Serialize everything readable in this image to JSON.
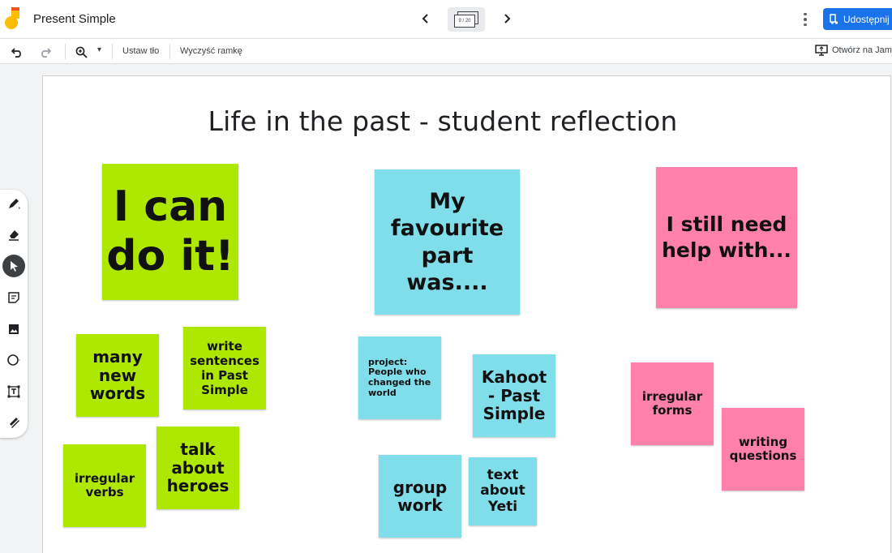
{
  "app": {
    "title": "Present Simple",
    "frame_indicator": "9 / 20",
    "share_label": "Udostępnij"
  },
  "toolbar": {
    "set_background": "Ustaw tło",
    "clear_frame": "Wyczyść ramkę",
    "open_in_jamboard": "Otwórz na Jamb",
    "zoom_caret": "▾"
  },
  "tools": [
    "pen-icon",
    "eraser-icon",
    "select-icon",
    "sticky-note-icon",
    "image-icon",
    "circle-shape-icon",
    "text-box-icon",
    "laser-icon"
  ],
  "board": {
    "title": "Life in the past - student reflection",
    "notes": {
      "can_do": "I can do it!",
      "many_words": "many new words",
      "write_sentences": "write sentences in Past Simple",
      "irregular_verbs": "irregular verbs",
      "talk_heroes": "talk about heroes",
      "favourite_part": "My favourite part was....",
      "project": "project: People who changed the world",
      "kahoot": "Kahoot - Past Simple",
      "group_work": "group work",
      "text_yeti": "text about Yeti",
      "need_help": "I still need help with...",
      "irregular_forms": "irregular forms",
      "writing_questions": "writing questions"
    }
  },
  "colors": {
    "lime": "#aee800",
    "cyan": "#80deea",
    "pink": "#ff80ab",
    "share_blue": "#1a73e8"
  }
}
